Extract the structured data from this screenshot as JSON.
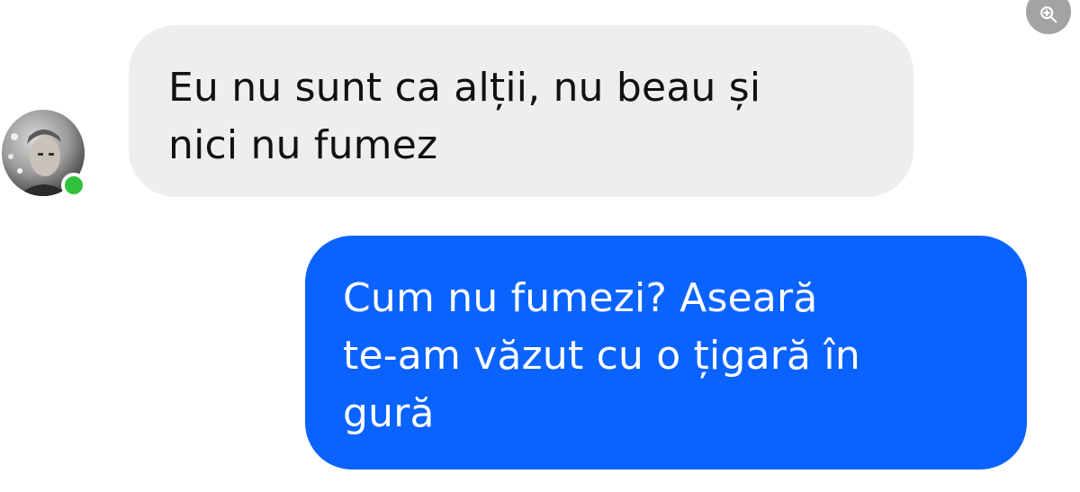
{
  "toolbar": {
    "zoom_icon": "zoom-in-icon"
  },
  "conversation": {
    "contact": {
      "avatar": "avatar",
      "status": "online",
      "status_color": "#32c13a"
    },
    "messages": [
      {
        "direction": "incoming",
        "lines": [
          "Eu nu sunt ca alții, nu beau și",
          "nici nu fumez"
        ],
        "bubble_color": "#eeeeee",
        "text_color": "#111111"
      },
      {
        "direction": "outgoing",
        "lines": [
          "Cum nu fumezi? Aseară",
          "te-am văzut cu o țigară în",
          "gură"
        ],
        "bubble_color": "#0a63ff",
        "text_color": "#ffffff"
      }
    ]
  }
}
